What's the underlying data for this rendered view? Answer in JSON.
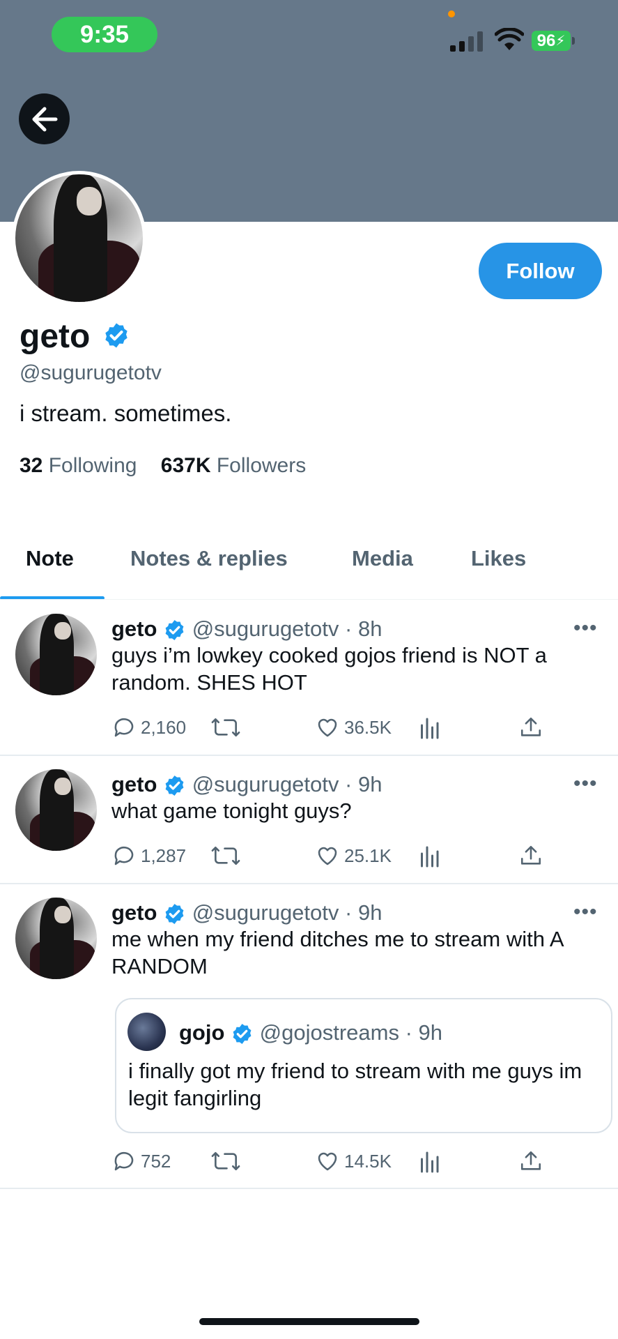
{
  "status_bar": {
    "time": "9:35",
    "battery": "96"
  },
  "profile": {
    "name": "geto",
    "handle": "@sugurugetotv",
    "bio": "i stream. sometimes.",
    "following_count": "32",
    "following_label": "Following",
    "followers_count": "637K",
    "followers_label": "Followers",
    "follow_label": "Follow"
  },
  "tabs": [
    {
      "label": "Note",
      "active": true
    },
    {
      "label": "Notes & replies",
      "active": false
    },
    {
      "label": "Media",
      "active": false
    },
    {
      "label": "Likes",
      "active": false
    }
  ],
  "tweets": [
    {
      "name": "geto",
      "handle": "@sugurugetotv",
      "time": "· 8h",
      "text": "guys i’m lowkey cooked gojos friend is NOT a random. SHES HOT",
      "replies": "2,160",
      "likes": "36.5K"
    },
    {
      "name": "geto",
      "handle": "@sugurugetotv",
      "time": "· 9h",
      "text": "what game tonight guys?",
      "replies": "1,287",
      "likes": "25.1K"
    },
    {
      "name": "geto",
      "handle": "@sugurugetotv",
      "time": "· 9h",
      "text": "me when my friend ditches me to stream with A RANDOM",
      "replies": "752",
      "likes": "14.5K",
      "quote": {
        "name": "gojo",
        "handle": "@gojostreams",
        "time": "· 9h",
        "text": "i finally got my friend to stream with me guys im legit fangirling"
      }
    }
  ],
  "colors": {
    "accent": "#1d9bf0",
    "banner": "#66788a",
    "status_green": "#34c759"
  }
}
